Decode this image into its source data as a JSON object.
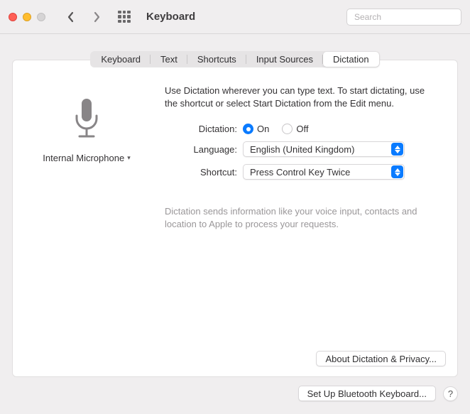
{
  "window": {
    "title": "Keyboard",
    "search_placeholder": "Search"
  },
  "tabs": {
    "items": [
      {
        "label": "Keyboard"
      },
      {
        "label": "Text"
      },
      {
        "label": "Shortcuts"
      },
      {
        "label": "Input Sources"
      },
      {
        "label": "Dictation"
      }
    ]
  },
  "mic": {
    "label": "Internal Microphone"
  },
  "dictation": {
    "intro": "Use Dictation wherever you can type text. To start dictating, use the shortcut or select Start Dictation from the Edit menu.",
    "dictation_label": "Dictation:",
    "on_label": "On",
    "off_label": "Off",
    "language_label": "Language:",
    "language_value": "English (United Kingdom)",
    "shortcut_label": "Shortcut:",
    "shortcut_value": "Press Control Key Twice",
    "note": "Dictation sends information like your voice input, contacts and location to Apple to process your requests.",
    "about_button": "About Dictation & Privacy..."
  },
  "footer": {
    "bluetooth_button": "Set Up Bluetooth Keyboard...",
    "help_label": "?"
  }
}
